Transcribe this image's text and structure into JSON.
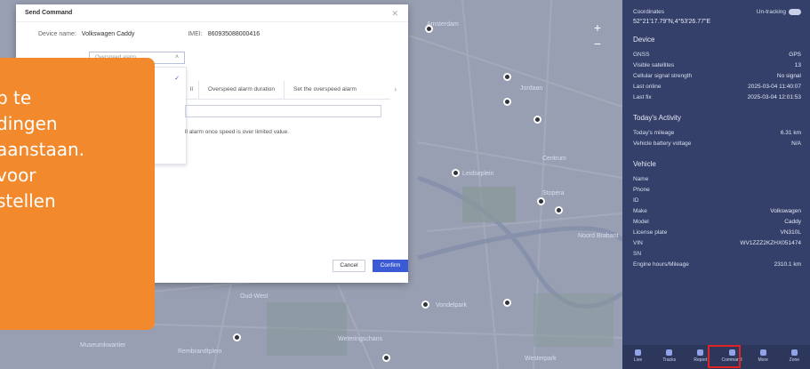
{
  "dialog": {
    "title": "Send Command",
    "close_icon": "close-icon",
    "device_name_label": "Device name:",
    "device_name_value": "Volkswagen Caddy",
    "imei_label": "IMEI:",
    "imei_value": "860935088000416",
    "command_placeholder": "Overspeed alarm",
    "dropdown_check": "✓",
    "dropdown_item_fragment": "rms",
    "tabs": [
      "ll",
      "Overspeed alarm duration",
      "Set the overspeed alarm"
    ],
    "hint": "ll alarm once speed is over limited value.",
    "cancel_label": "Cancel",
    "confirm_label": "Confirm"
  },
  "callout": {
    "lines": [
      "p te",
      "dingen",
      "aanstaan.",
      "voor",
      "stellen"
    ]
  },
  "panel": {
    "coordinates_label": "Coordinates",
    "coordinates_mode": "Un-tracking",
    "coordinates_value": "52°21'17.79\"N,4°53'26.77\"E",
    "device_heading": "Device",
    "device_rows": [
      {
        "label": "GNSS",
        "value": "GPS"
      },
      {
        "label": "Visible satellites",
        "value": "13"
      },
      {
        "label": "Cellular signal strength",
        "value": "No signal"
      },
      {
        "label": "Last online",
        "value": "2025-03-04 11:40:07"
      },
      {
        "label": "Last fix",
        "value": "2025-03-04 12:01:53"
      }
    ],
    "activity_heading": "Today's Activity",
    "activity_rows": [
      {
        "label": "Today's mileage",
        "value": "6.31 km"
      },
      {
        "label": "Vehicle battery voltage",
        "value": "N/A"
      }
    ],
    "vehicle_heading": "Vehicle",
    "vehicle_rows": [
      {
        "label": "Name",
        "value": ""
      },
      {
        "label": "Phone",
        "value": ""
      },
      {
        "label": "ID",
        "value": ""
      },
      {
        "label": "Make",
        "value": "Volkswagen"
      },
      {
        "label": "Model",
        "value": "Caddy"
      },
      {
        "label": "License plate",
        "value": "VN310L"
      },
      {
        "label": "VIN",
        "value": "WV1ZZZ2KZHX051474"
      },
      {
        "label": "SN",
        "value": ""
      },
      {
        "label": "Engine hours/Mileage",
        "value": "2310.1 km"
      }
    ],
    "bottom_items": [
      "Live",
      "Tracks",
      "Report",
      "Command",
      "More",
      "Zone"
    ]
  },
  "map": {
    "labels": [
      "Amsterdam",
      "Jordaan",
      "Centrum",
      "Stopera",
      "Noord Brabant",
      "Leidseplein",
      "Vondelpark",
      "Oud-West",
      "Museumkwartier",
      "Rembrandtplein",
      "Weteringschans",
      "Westerpark"
    ],
    "zoom_in": "+",
    "zoom_out": "−"
  },
  "accent_colors": {
    "callout": "#f28a2d",
    "confirm": "#3b5bd6",
    "panel": "#35406a",
    "highlight": "#e02424"
  }
}
